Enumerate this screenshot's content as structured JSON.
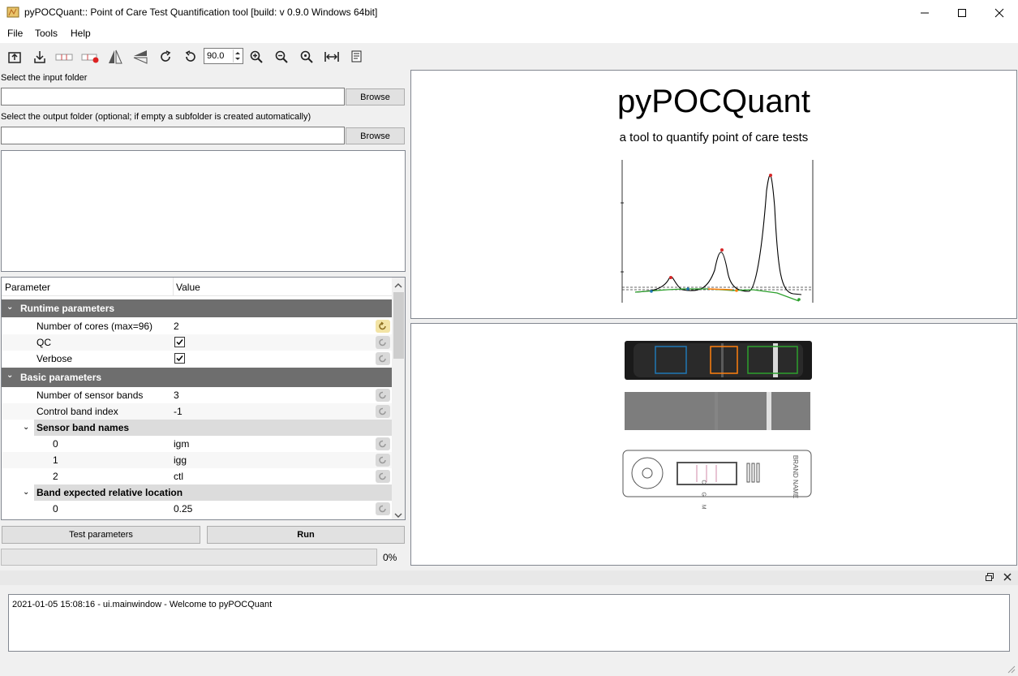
{
  "window": {
    "title": "pyPOCQuant:: Point of Care Test Quantification tool [build: v 0.9.0 Windows 64bit]",
    "icons": [
      "minimize-icon",
      "maximize-icon",
      "close-icon"
    ]
  },
  "menu": [
    "File",
    "Tools",
    "Help"
  ],
  "toolbar": {
    "icons": [
      "open-folder-icon",
      "save-icon",
      "select-strip-icon",
      "delete-strip-icon",
      "mirror-vertical-icon",
      "mirror-horizontal-icon",
      "rotate-right-icon",
      "rotate-left-icon",
      "zoom-in-icon",
      "zoom-out-icon",
      "zoom-reset-icon",
      "fit-width-icon",
      "log-icon"
    ],
    "rotation_value": "90.0"
  },
  "input": {
    "input_label": "Select the input folder",
    "input_value": "",
    "browse_label": "Browse",
    "output_label": "Select the output folder (optional; if empty a subfolder is created automatically)",
    "output_value": ""
  },
  "params": {
    "col_parameter": "Parameter",
    "col_value": "Value",
    "runtime_group": "Runtime parameters",
    "cores_label": "Number of cores (max=96)",
    "cores_value": "2",
    "qc_label": "QC",
    "qc_checked": true,
    "verbose_label": "Verbose",
    "verbose_checked": true,
    "basic_group": "Basic parameters",
    "num_bands_label": "Number of sensor bands",
    "num_bands_value": "3",
    "control_index_label": "Control band index",
    "control_index_value": "-1",
    "band_names_label": "Sensor band names",
    "band_names": [
      {
        "index": "0",
        "value": "igm"
      },
      {
        "index": "1",
        "value": "igg"
      },
      {
        "index": "2",
        "value": "ctl"
      }
    ],
    "expected_loc_label": "Band expected relative location",
    "expected_loc": [
      {
        "index": "0",
        "value": "0.25"
      }
    ]
  },
  "actions": {
    "test_label": "Test parameters",
    "run_label": "Run",
    "progress_percent": 0,
    "progress_text": "0%"
  },
  "splash": {
    "title": "pyPOCQuant",
    "subtitle": "a tool to quantify point of care tests"
  },
  "cassette_brand": "BRAND NAME",
  "cassette_lanes": "C G M",
  "log": {
    "lines": [
      "2021-01-05 15:08:16 - ui.mainwindow - Welcome to pyPOCQuant"
    ]
  },
  "colors": {
    "group_bg": "#6e6e6e",
    "band_blue": "#1f77b4",
    "band_orange": "#ff7f0e",
    "band_green": "#2ca02c"
  }
}
